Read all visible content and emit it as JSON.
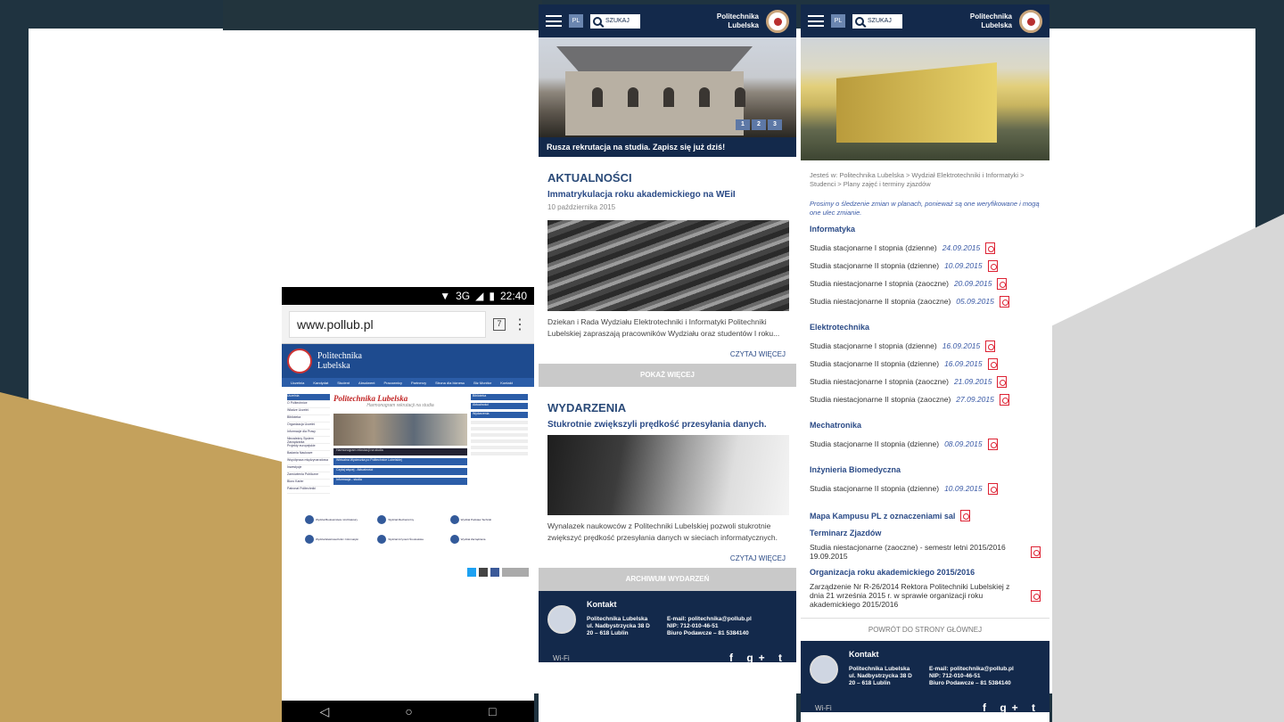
{
  "phone": {
    "status_time": "22:40",
    "status_net": "3G",
    "url": "www.pollub.pl",
    "tabs_count": "7",
    "site_name": [
      "Politechnika",
      "Lubelska"
    ],
    "header_title": "Politechnika Lubelska",
    "header_sub": "Harmonogram rekrutacji na studia",
    "nav": [
      "Uczelnia",
      "Kandydat",
      "Student",
      "Absolwent",
      "Pracownicy",
      "Partnerzy",
      "Strona dla biznesu",
      "Biz Monitor",
      "Kontakt"
    ],
    "side": [
      "Uczelnia",
      "O Politechnice",
      "Władze Uczelni",
      "Biblioteka",
      "Organizacja Uczelni",
      "Informacje dla Prasy",
      "Niezależny System Zarządzania",
      "Projekty europejskie",
      "Badania Naukowe",
      "Współpraca międzynarodowa",
      "Inwestycje",
      "Zamówienia Publiczne",
      "Biuro Karier",
      "Patronat Politechniki"
    ],
    "banner_cap": "Harmonogram rekrutacji na studia",
    "bars": [
      "Wirtualna Wycieczka po Politechnice Lubelskiej",
      "Czytaj więcej - Aktualności",
      "Informacja - studia"
    ],
    "right": [
      "Biblioteka",
      "Aktualności",
      "Wydarzenia"
    ],
    "faculties": [
      "Wydział Budownictwa i Architektury",
      "Wydział Mechaniczny",
      "Wydział Podstaw Techniki",
      "Wydział Elektrotechniki i Informatyki",
      "Wydział Inżynierii Środowiska",
      "Wydział Zarządzania"
    ]
  },
  "m1": {
    "lang": "PL",
    "search": "SZUKAJ",
    "brand": [
      "Politechnika",
      "Lubelska"
    ],
    "slides": [
      "1",
      "2",
      "3"
    ],
    "hero_caption": "Rusza rekrutacja na studia. Zapisz się już dziś!",
    "news_heading": "AKTUALNOŚCI",
    "news_title": "Immatrykulacja roku akademickiego na WEiI",
    "news_date": "10 października 2015",
    "news_text": "Dziekan i Rada Wydziału Elektrotechniki i Informatyki Politechniki Lubelskiej zapraszają pracowników Wydziału oraz studentów I roku...",
    "read_more": "CZYTAJ WIĘCEJ",
    "show_more": "POKAŻ WIĘCEJ",
    "events_heading": "WYDARZENIA",
    "event_title": "Stukrotnie zwiększyli prędkość przesyłania danych.",
    "event_text": "Wynalazek naukowców z Politechniki Lubelskiej pozwoli stukrotnie zwiększyć prędkość przesyłania danych w sieciach informatycznych.",
    "read_more2": "CZYTAJ WIĘCEJ",
    "archive": "ARCHIWUM WYDARZEŃ"
  },
  "footer": {
    "heading": "Kontakt",
    "addr": [
      "Politechnika Lubelska",
      "ul. Nadbystrzycka 38 D",
      "20 – 618 Lublin"
    ],
    "contact": [
      "E-mail: politechnika@pollub.pl",
      "NIP: 712-010-46-51",
      "Biuro Podawcze – 81 5384140"
    ],
    "wifi": "Wi-Fi",
    "social": "f g+ t"
  },
  "m2": {
    "lang": "PL",
    "search": "SZUKAJ",
    "brand": [
      "Politechnika",
      "Lubelska"
    ],
    "breadcrumb": "Jesteś w: Politechnika Lubelska > Wydział Elektrotechniki i Informatyki > Studenci > Plany zajęć i terminy zjazdów",
    "notice": "Prosimy o śledzenie zmian w planach, ponieważ są one weryfikowane i mogą one ulec zmianie.",
    "sections": [
      {
        "title": "Informatyka",
        "rows": [
          [
            "Studia stacjonarne I stopnia (dzienne)",
            "24.09.2015"
          ],
          [
            "Studia stacjonarne II stopnia (dzienne)",
            "10.09.2015"
          ],
          [
            "Studia niestacjonarne I stopnia (zaoczne)",
            "20.09.2015"
          ],
          [
            "Studia niestacjonarne II stopnia (zaoczne)",
            "05.09.2015"
          ]
        ]
      },
      {
        "title": "Elektrotechnika",
        "rows": [
          [
            "Studia stacjonarne I stopnia (dzienne)",
            "16.09.2015"
          ],
          [
            "Studia stacjonarne II stopnia (dzienne)",
            "16.09.2015"
          ],
          [
            "Studia niestacjonarne I stopnia (zaoczne)",
            "21.09.2015"
          ],
          [
            "Studia niestacjonarne II stopnia (zaoczne)",
            "27.09.2015"
          ]
        ]
      },
      {
        "title": "Mechatronika",
        "rows": [
          [
            "Studia stacjonarne II stopnia (dzienne)",
            "08.09.2015"
          ]
        ]
      },
      {
        "title": "Inżynieria Biomedyczna",
        "rows": [
          [
            "Studia stacjonarne II stopnia (dzienne)",
            "10.09.2015"
          ]
        ]
      }
    ],
    "map": "Mapa Kampusu PL z oznaczeniami sal",
    "term_title": "Terminarz Zjazdów",
    "term_text": "Studia niestacjonarne (zaoczne) - semestr letni 2015/2016 19.09.2015",
    "org_title": "Organizacja roku akademickiego 2015/2016",
    "org_text": "Zarządzenie Nr R-26/2014 Rektora Politechniki Lubelskiej z dnia 21 września 2015 r. w sprawie organizacji roku akademickiego 2015/2016",
    "back": "POWRÓT DO STRONY GŁÓWNEJ"
  }
}
